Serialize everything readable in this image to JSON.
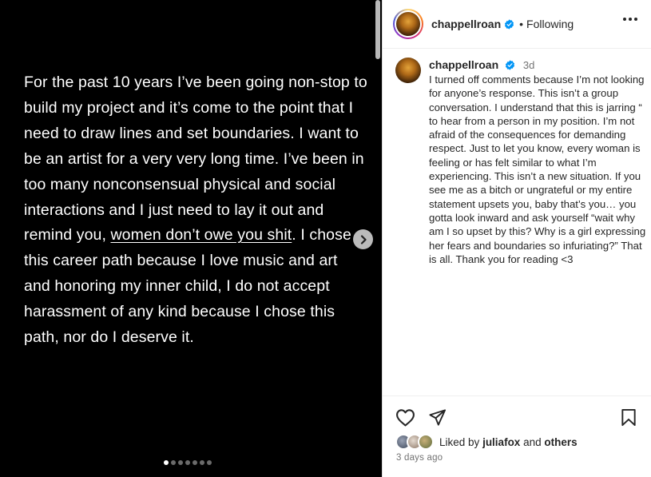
{
  "media": {
    "text_lines_before": "For the past 10 years I’ve been going non-stop to build my project and it’s come to the point that I need to draw lines and set boundaries. I want to be an artist for a very very long time. I’ve been in too many nonconsensual physical and social interactions and I just need to lay it out and remind you, ",
    "underlined": "women don’t owe you shit",
    "text_after": ". I chose this career path because I love music and art and honoring my inner child, I do not accept harassment of any kind because I chose this path, nor do I deserve it.",
    "slide_count": 7,
    "active_slide": 1
  },
  "header": {
    "username": "chappellroan",
    "separator": "•",
    "follow_status": "Following"
  },
  "caption": {
    "username": "chappellroan",
    "time": "3d",
    "text": "I turned off comments because I’m not looking for anyone’s response. This isn’t a group conversation. I understand that this is jarring “ to hear from a person in my position. I’m not afraid of the consequences for demanding respect. Just to let you know, every woman is feeling or has felt similar to what I’m experiencing. This isn’t a new situation. If you see me as a bitch or ungrateful or my entire statement upsets you, baby that’s you… you gotta look inward and ask yourself “wait why am I so upset by this? Why is a girl expressing her fears and boundaries so infuriating?” That is all. Thank you for reading <3"
  },
  "likes": {
    "prefix": "Liked by",
    "user": "juliafox",
    "and": "and",
    "others": "others"
  },
  "posted": "3 days ago",
  "colors": {
    "verified": "#0095f6",
    "text": "#262626",
    "muted": "#737373"
  },
  "icons": [
    "verified-badge-icon",
    "more-options-icon",
    "heart-icon",
    "share-icon",
    "bookmark-icon",
    "chevron-right-icon"
  ]
}
